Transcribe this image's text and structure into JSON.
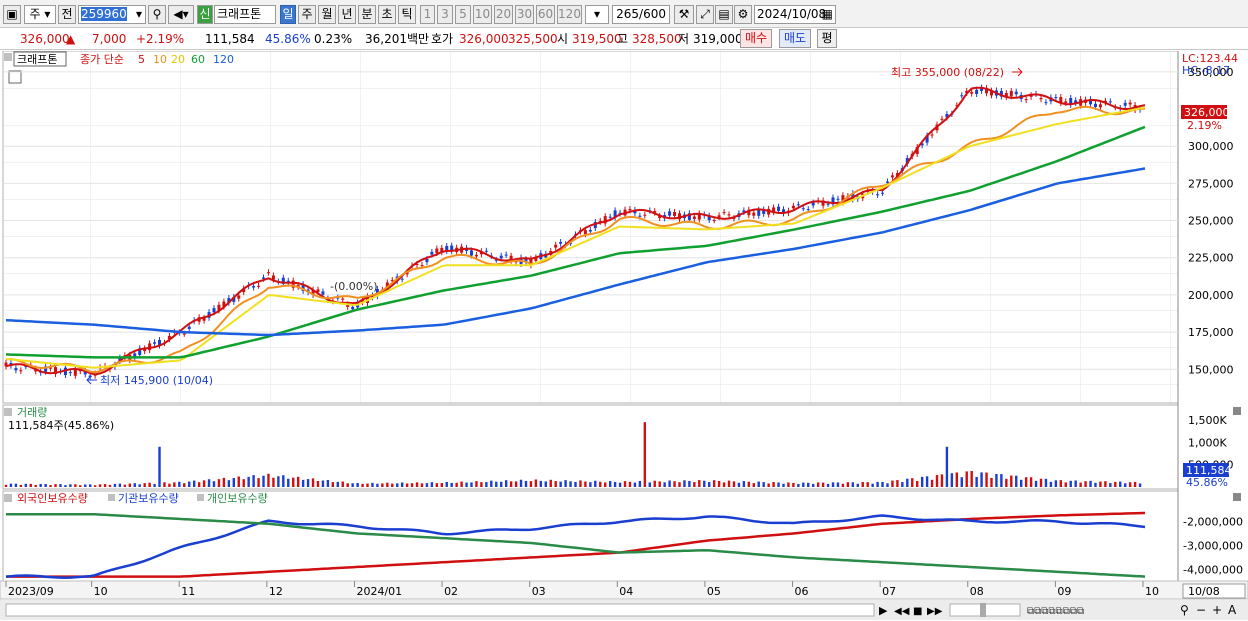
{
  "toolbar": {
    "market_type": "주",
    "prev": "전",
    "code": "259960",
    "new_badge": "신",
    "stock_name": "크래프톤",
    "periods": [
      "일",
      "주",
      "월",
      "년",
      "분",
      "초",
      "틱"
    ],
    "active_period": "일",
    "intervals": [
      "1",
      "3",
      "5",
      "10",
      "20",
      "30",
      "60",
      "120"
    ],
    "count": "265",
    "total": "/600",
    "date": "2024/10/08"
  },
  "quote": {
    "price": "326,000",
    "arrow": "▲",
    "change": "7,000",
    "change_pct": "+2.19%",
    "volume": "111,584",
    "volume_ratio": "45.86%",
    "turnover_rate": "0.23%",
    "amount": "36,201백만",
    "ask_label": "호가",
    "ask": "326,000",
    "bid": "325,500",
    "open_label": "시",
    "open": "319,500",
    "high_label": "고",
    "high": "328,500",
    "low_label": "저",
    "low": "319,000",
    "buy_btn": "매수",
    "sell_btn": "매도",
    "eval_btn": "평"
  },
  "legend": {
    "name": "크래프톤",
    "ma_title": "종가 단순",
    "ma_periods": [
      "5",
      "10",
      "20",
      "60",
      "120"
    ],
    "ma_colors": [
      "#d01010",
      "#f09020",
      "#f0e020",
      "#10a030",
      "#1a5fe0"
    ]
  },
  "price_panel": {
    "lc": "LC:123.44",
    "hc": "HC:-8.17",
    "current_price": "326,000",
    "current_pct": "2.19%",
    "high_note": "최고 355,000 (08/22)",
    "low_note": "최저 145,900 (10/04)",
    "mid_note": "-(0.00%)",
    "y_labels": [
      "350,000",
      "300,000",
      "275,000",
      "250,000",
      "225,000",
      "200,000",
      "175,000",
      "150,000"
    ]
  },
  "volume_panel": {
    "title": "거래량",
    "info": "111,584주(45.86%)",
    "y_labels": [
      "1,500K",
      "1,000K",
      "500,000"
    ],
    "current": "111,584",
    "current_pct": "45.86%"
  },
  "holding_panel": {
    "legend": [
      "외국인보유수량",
      "기관보유수량",
      "개인보유수량"
    ],
    "colors": [
      "#d01010",
      "#1a3fd0",
      "#2a8a48"
    ],
    "y_labels": [
      "-2,000,000",
      "-3,000,000",
      "-4,000,000"
    ]
  },
  "x_axis": [
    "2023/09",
    "10",
    "11",
    "12",
    "2024/01",
    "02",
    "03",
    "04",
    "05",
    "06",
    "07",
    "08",
    "09",
    "10",
    "10/08"
  ],
  "chart_data": {
    "type": "line",
    "title": "",
    "x": [
      "2023/09",
      "10",
      "11",
      "12",
      "2024/01",
      "02",
      "03",
      "04",
      "05",
      "06",
      "07",
      "08",
      "09",
      "10"
    ],
    "series": [
      {
        "values": [
          152000,
          147000,
          175000,
          213000,
          192000,
          232000,
          222000,
          256000,
          252000,
          258000,
          270000,
          338000,
          331000,
          326000
        ]
      },
      {
        "values": [
          155000,
          150000,
          160000,
          207000,
          196000,
          226000,
          220000,
          251000,
          246000,
          250000,
          275000,
          300000,
          325000,
          323000
        ]
      },
      {
        "values": [
          157000,
          151000,
          156000,
          200000,
          193000,
          220000,
          220000,
          246000,
          244000,
          248000,
          272000,
          300000,
          315000,
          326000
        ]
      },
      {
        "values": [
          160000,
          158000,
          158000,
          172000,
          190000,
          203000,
          213000,
          228000,
          233000,
          244000,
          256000,
          270000,
          290000,
          313000
        ]
      },
      {
        "values": [
          183000,
          180000,
          175000,
          173000,
          176000,
          180000,
          191000,
          207000,
          222000,
          231000,
          242000,
          257000,
          275000,
          285000
        ]
      }
    ],
    "ylim": [
      130000,
      362000
    ],
    "volume": {
      "values": [
        80,
        60,
        120,
        300,
        90,
        110,
        170,
        130,
        160,
        100,
        120,
        380,
        160,
        110
      ],
      "max_k": 1700
    },
    "holdings": {
      "ylim": [
        -4400000,
        -1400000
      ],
      "series": [
        {
          "name": "외국인보유수량",
          "values": [
            -4300000,
            -4300000,
            -4300000,
            -4100000,
            -3900000,
            -3700000,
            -3500000,
            -3300000,
            -2800000,
            -2500000,
            -2100000,
            -1900000,
            -1750000,
            -1650000
          ]
        },
        {
          "name": "기관보유수량",
          "values": [
            -4300000,
            -4300000,
            -3100000,
            -2000000,
            -2200000,
            -2500000,
            -2300000,
            -2000000,
            -1800000,
            -2100000,
            -1800000,
            -2000000,
            -2000000,
            -2200000
          ]
        },
        {
          "name": "개인보유수량",
          "values": [
            -1700000,
            -1700000,
            -1900000,
            -2100000,
            -2500000,
            -2700000,
            -2900000,
            -3300000,
            -3200000,
            -3500000,
            -3700000,
            -3900000,
            -4100000,
            -4300000
          ]
        }
      ]
    }
  }
}
